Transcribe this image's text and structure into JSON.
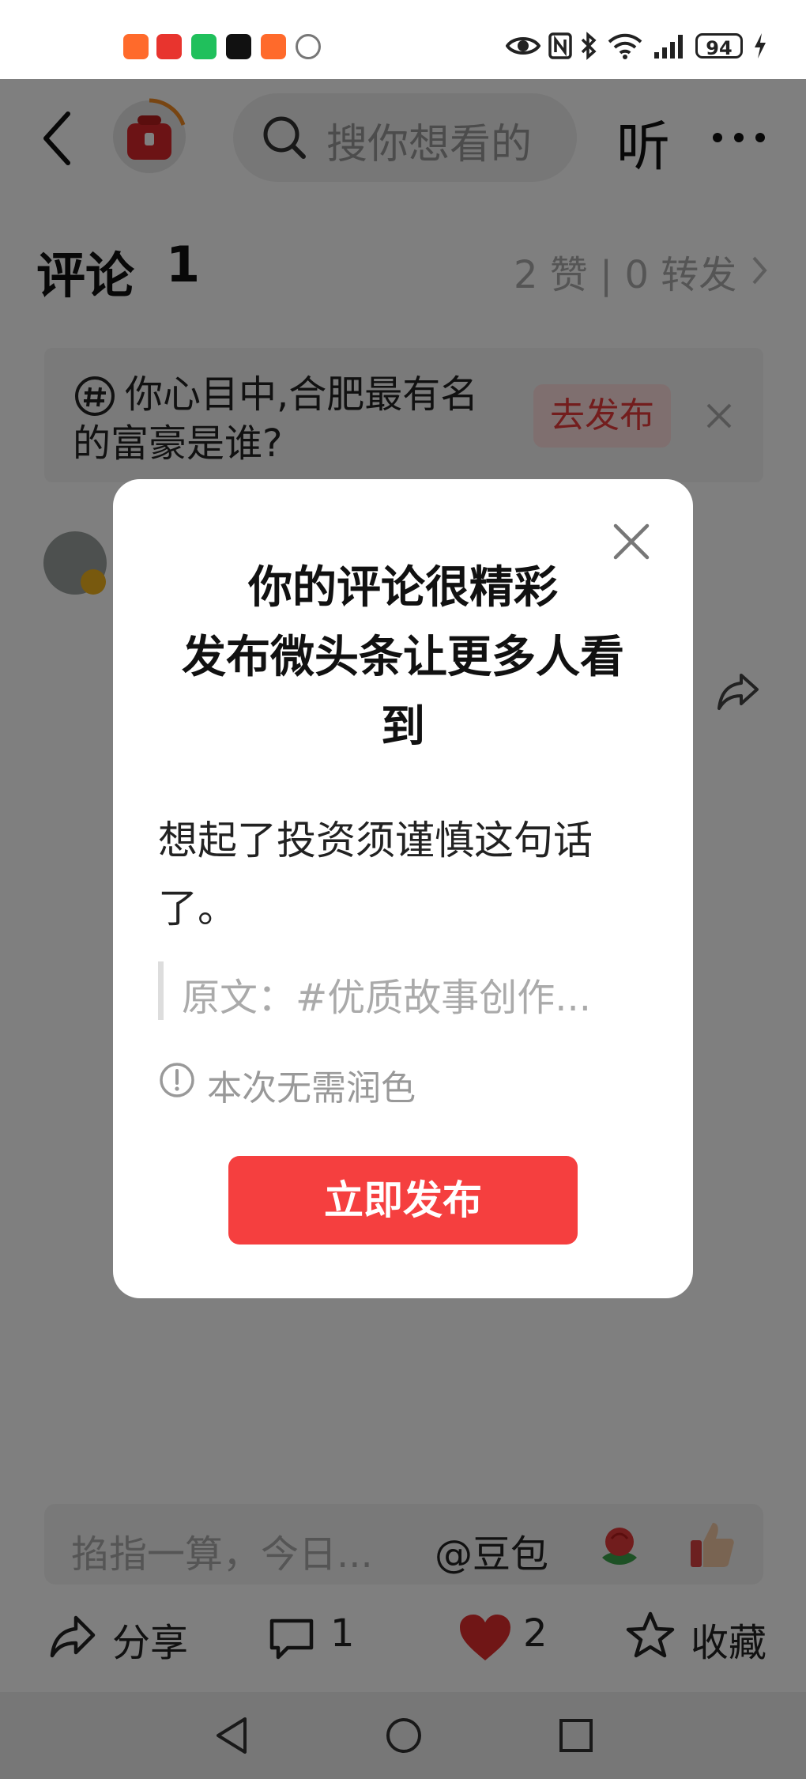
{
  "status_bar": {
    "battery": "94",
    "colors": {
      "app1": "#ff6a2b",
      "app2": "#e8342e",
      "app3": "#20c05c",
      "app4": "#111111",
      "app5": "#ff6a2b",
      "app6": "#9e9e9e"
    }
  },
  "nav": {
    "search_placeholder": "搜你想看的",
    "listen_label": "听",
    "back_icon": "chevron-left-icon",
    "more_icon": "more-dots-icon"
  },
  "comments": {
    "title": "评论",
    "count": "1",
    "stats": "2 赞 | 0 转发"
  },
  "topic": {
    "text": "你心目中,合肥最有名的富豪是谁?",
    "publish_label": "去发布"
  },
  "modal": {
    "title_line1": "你的评论很精彩",
    "title_line2": "发布微头条让更多人看到",
    "body": "想起了投资须谨慎这句话了。",
    "original": "原文：#优质故事创作...",
    "tip": "本次无需润色",
    "cta": "立即发布"
  },
  "input_bar": {
    "placeholder": "掐指一算，今日...",
    "doubao": "@豆包"
  },
  "actions": {
    "share_label": "分享",
    "comment_count": "1",
    "like_count": "2",
    "favorite_label": "收藏"
  },
  "colors": {
    "accent_red": "#f53f3f",
    "heart_red": "#e02d2d",
    "overlay": "rgba(0,0,0,0.5)"
  }
}
